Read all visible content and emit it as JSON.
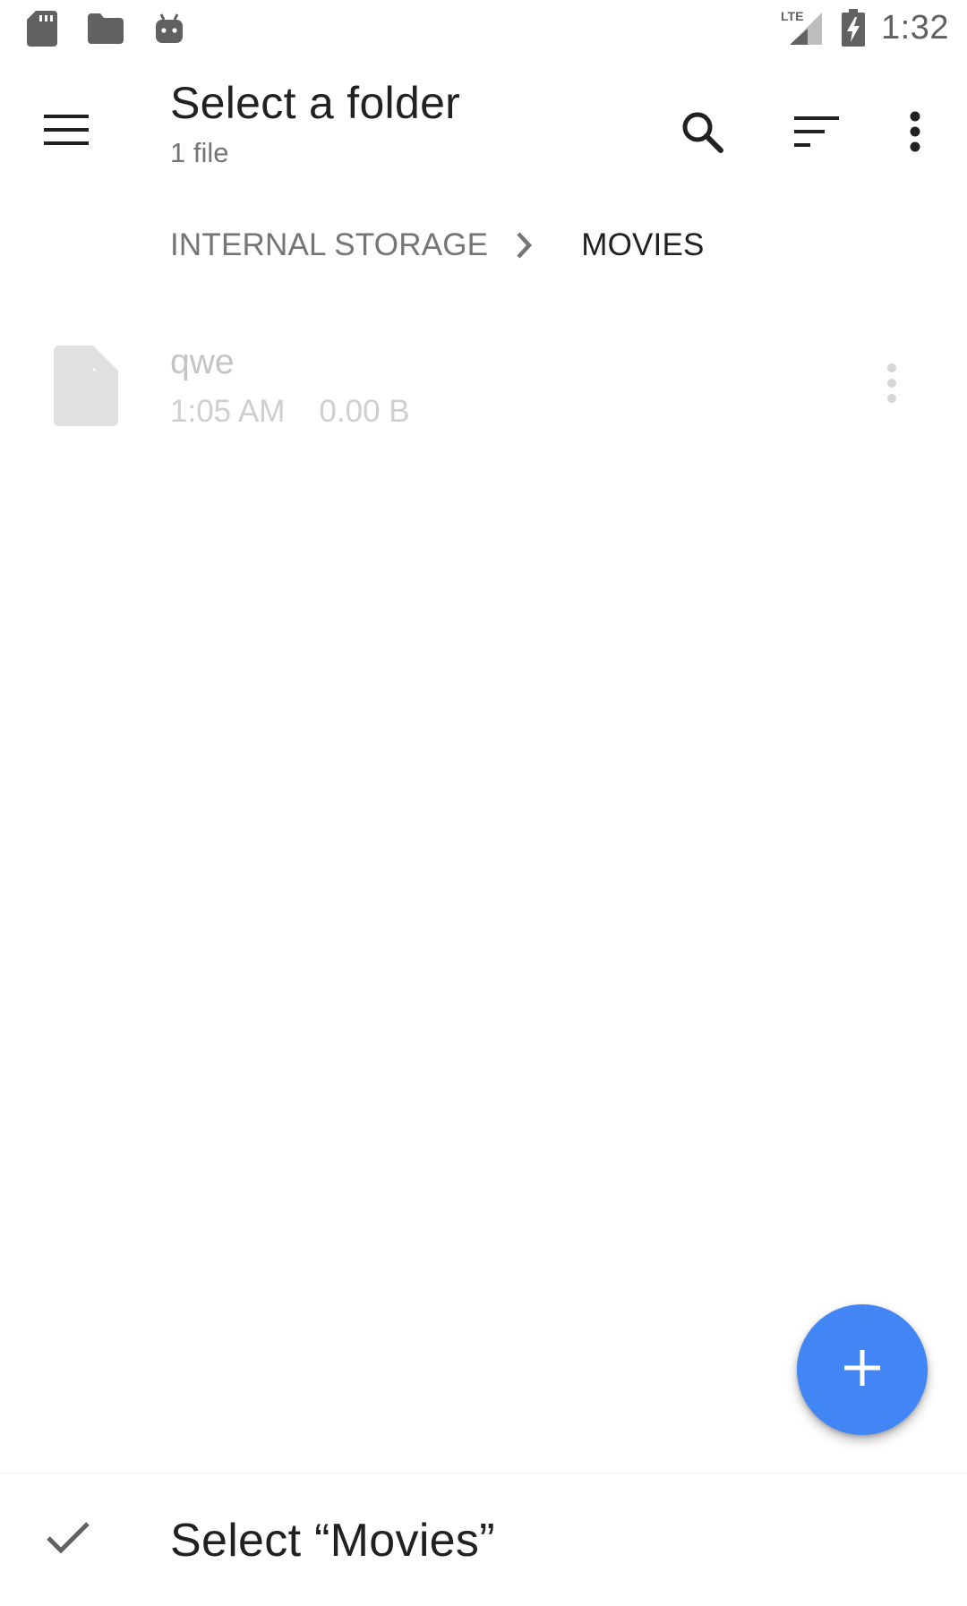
{
  "status_bar": {
    "icons": [
      "sd-card-icon",
      "folder-icon",
      "android-debug-icon"
    ],
    "network": "LTE",
    "time": "1:32"
  },
  "app_bar": {
    "title": "Select a folder",
    "subtitle": "1 file",
    "actions": [
      "search-icon",
      "sort-icon",
      "more-vert-icon"
    ]
  },
  "breadcrumb": {
    "items": [
      "INTERNAL STORAGE",
      "MOVIES"
    ]
  },
  "files": [
    {
      "name": "qwe",
      "time": "1:05 AM",
      "size": "0.00 B"
    }
  ],
  "fab": {
    "icon": "add-icon",
    "color": "#4285f4"
  },
  "bottom": {
    "label": "Select “Movies”",
    "icon": "check-icon"
  },
  "colors": {
    "accent": "#4285f4",
    "text_primary": "#212121",
    "text_secondary": "#757575",
    "disabled": "#c4c4c4"
  }
}
